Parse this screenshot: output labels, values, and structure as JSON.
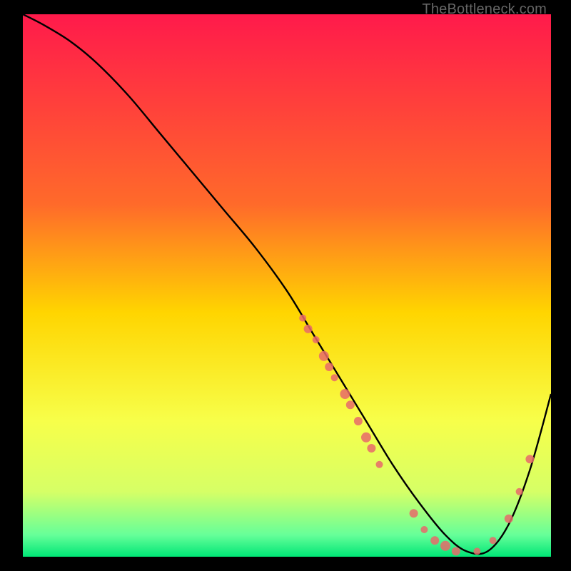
{
  "watermark": "TheBottleneck.com",
  "chart_data": {
    "type": "line",
    "title": "",
    "xlabel": "",
    "ylabel": "",
    "xlim": [
      0,
      100
    ],
    "ylim": [
      0,
      100
    ],
    "gradient_stops": [
      {
        "offset": 0,
        "color": "#ff1a4b"
      },
      {
        "offset": 35,
        "color": "#ff6a2a"
      },
      {
        "offset": 55,
        "color": "#ffd500"
      },
      {
        "offset": 75,
        "color": "#f7ff4a"
      },
      {
        "offset": 88,
        "color": "#d6ff66"
      },
      {
        "offset": 96,
        "color": "#66ff99"
      },
      {
        "offset": 100,
        "color": "#00e676"
      }
    ],
    "series": [
      {
        "name": "bottleneck-curve",
        "x": [
          0,
          4,
          9,
          14,
          20,
          26,
          32,
          38,
          44,
          50,
          55,
          60,
          65,
          70,
          75,
          80,
          84,
          88,
          92,
          96,
          100
        ],
        "y": [
          100,
          98,
          95,
          91,
          85,
          78,
          71,
          64,
          57,
          49,
          41,
          33,
          25,
          17,
          10,
          4,
          1,
          1,
          6,
          16,
          30
        ]
      }
    ],
    "markers": {
      "name": "highlighted-points",
      "color": "#e86a6a",
      "points": [
        {
          "x": 53,
          "y": 44,
          "r": 5
        },
        {
          "x": 54,
          "y": 42,
          "r": 6
        },
        {
          "x": 55.5,
          "y": 40,
          "r": 5
        },
        {
          "x": 57,
          "y": 37,
          "r": 7
        },
        {
          "x": 58,
          "y": 35,
          "r": 6
        },
        {
          "x": 59,
          "y": 33,
          "r": 5
        },
        {
          "x": 61,
          "y": 30,
          "r": 7
        },
        {
          "x": 62,
          "y": 28,
          "r": 6
        },
        {
          "x": 63.5,
          "y": 25,
          "r": 6
        },
        {
          "x": 65,
          "y": 22,
          "r": 7
        },
        {
          "x": 66,
          "y": 20,
          "r": 6
        },
        {
          "x": 67.5,
          "y": 17,
          "r": 5
        },
        {
          "x": 74,
          "y": 8,
          "r": 6
        },
        {
          "x": 76,
          "y": 5,
          "r": 5
        },
        {
          "x": 78,
          "y": 3,
          "r": 6
        },
        {
          "x": 80,
          "y": 2,
          "r": 7
        },
        {
          "x": 82,
          "y": 1,
          "r": 6
        },
        {
          "x": 86,
          "y": 1,
          "r": 5
        },
        {
          "x": 89,
          "y": 3,
          "r": 5
        },
        {
          "x": 92,
          "y": 7,
          "r": 6
        },
        {
          "x": 94,
          "y": 12,
          "r": 5
        },
        {
          "x": 96,
          "y": 18,
          "r": 6
        }
      ]
    }
  }
}
